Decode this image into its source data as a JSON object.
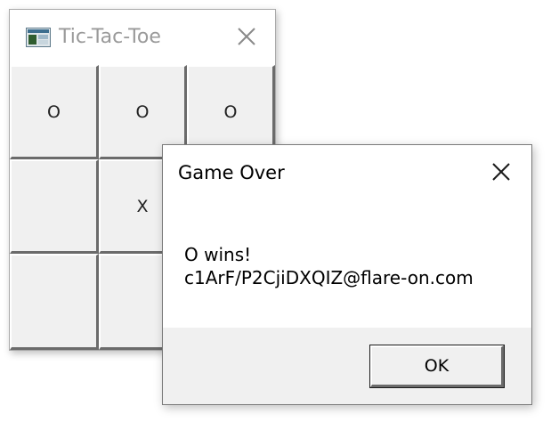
{
  "game_window": {
    "title": "Tic-Tac-Toe",
    "title_color": "#9a9a9a",
    "app_icon": "app-window-icon",
    "close_icon": "close-icon",
    "board": [
      [
        "O",
        "O",
        "O"
      ],
      [
        "",
        "X",
        ""
      ],
      [
        "",
        "",
        ""
      ]
    ]
  },
  "dialog": {
    "title": "Game Over",
    "close_icon": "close-icon",
    "message_line1": "O wins!",
    "message_line2": "c1ArF/P2CjiDXQIZ@flare-on.com",
    "ok_label": "OK"
  },
  "colors": {
    "face": "#f0f0f0",
    "shadow": "#6b6b6b",
    "highlight": "#ffffff"
  }
}
